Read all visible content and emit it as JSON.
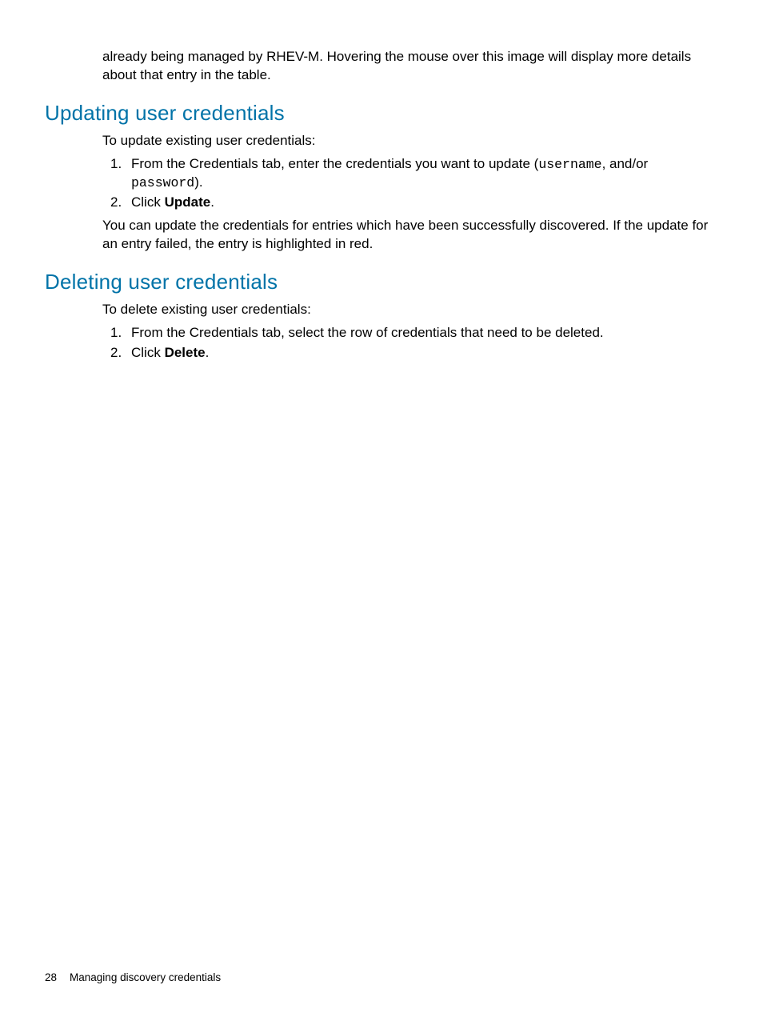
{
  "intro_paragraph": "already being managed by RHEV-M. Hovering the mouse over this image will display more details about that entry in the table.",
  "section_update": {
    "heading": "Updating user credentials",
    "lead": "To update existing user credentials:",
    "step1_pre": "From the Credentials tab, enter the credentials you want to update (",
    "step1_code1": "username",
    "step1_mid": ", and/or ",
    "step1_code2": "password",
    "step1_post": ").",
    "step2_pre": "Click ",
    "step2_bold": "Update",
    "step2_post": ".",
    "after": "You can update the credentials for entries which have been successfully discovered. If the update for an entry failed, the entry is highlighted in red."
  },
  "section_delete": {
    "heading": "Deleting user credentials",
    "lead": "To delete existing user credentials:",
    "step1": "From the Credentials tab, select the row of credentials that need to be deleted.",
    "step2_pre": "Click ",
    "step2_bold": "Delete",
    "step2_post": "."
  },
  "footer": {
    "page": "28",
    "title": "Managing discovery credentials"
  }
}
